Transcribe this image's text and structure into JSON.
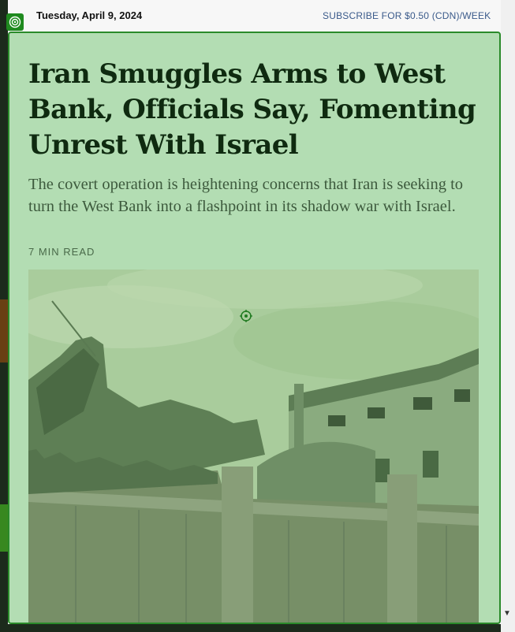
{
  "header": {
    "date": "Tuesday, April 9, 2024",
    "subscribe_label": "SUBSCRIBE FOR $0.50 (CDN)/WEEK"
  },
  "article": {
    "headline": "Iran Smuggles Arms to West Bank, Officials Say, Fomenting Unrest With Israel",
    "summary": "The covert operation is heightening concerns that Iran is seeking to turn the West Bank into a flashpoint in its shadow war with Israel.",
    "read_time": "7 MIN READ",
    "image_subject": "damaged buildings and rubble behind a concrete wall"
  },
  "icons": {
    "corner_badge": "target-icon",
    "center_marker": "target-icon",
    "scroll_arrow": "chevron-down-icon"
  },
  "colors": {
    "overlay": "#b3ddb3",
    "overlay_border": "#2a8a2a",
    "headline": "#0f2a10",
    "subscribe_link": "#3a5a8a"
  }
}
